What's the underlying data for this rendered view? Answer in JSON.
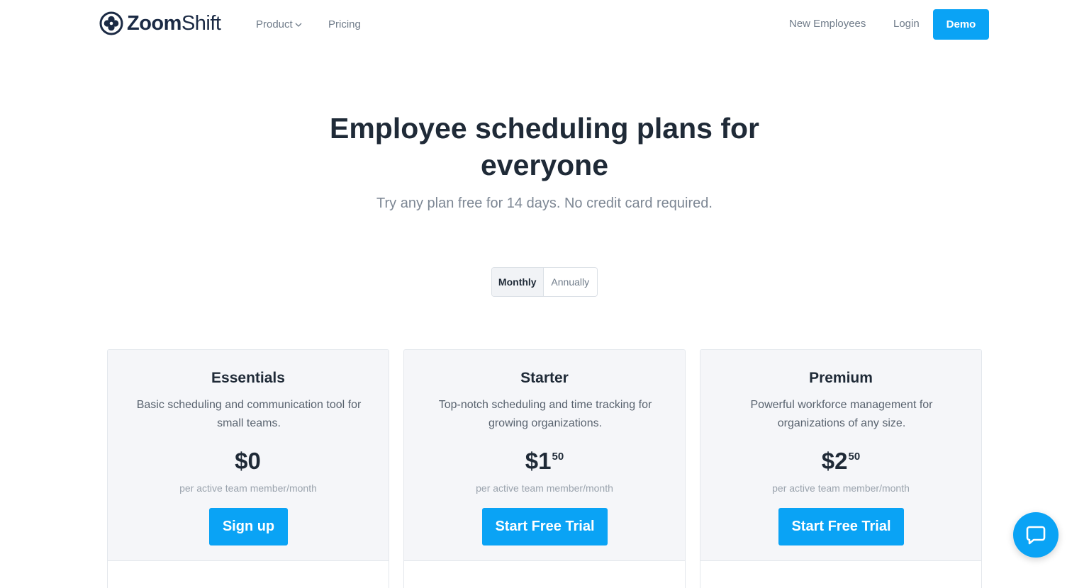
{
  "nav": {
    "logo_bold": "Zoom",
    "logo_light": "Shift",
    "product_label": "Product",
    "pricing_label": "Pricing",
    "new_employees_label": "New Employees",
    "login_label": "Login",
    "demo_label": "Demo"
  },
  "hero": {
    "title_line1": "Employee scheduling plans for",
    "title_line2": "everyone",
    "subtitle": "Try any plan free for 14 days. No credit card required."
  },
  "billing_toggle": {
    "monthly_label": "Monthly",
    "annually_label": "Annually",
    "selected": "Monthly"
  },
  "plans": [
    {
      "name": "Essentials",
      "description": "Basic scheduling and communication tool for small teams.",
      "price_main": "$0",
      "price_cents": "",
      "price_note": "per active team member/month",
      "cta_label": "Sign up"
    },
    {
      "name": "Starter",
      "description": "Top-notch scheduling and time tracking for growing organizations.",
      "price_main": "$1",
      "price_cents": "50",
      "price_note": "per active team member/month",
      "cta_label": "Start Free Trial"
    },
    {
      "name": "Premium",
      "description": "Powerful workforce management for organizations of any size.",
      "price_main": "$2",
      "price_cents": "50",
      "price_note": "per active team member/month",
      "cta_label": "Start Free Trial"
    }
  ],
  "icons": {
    "logo": "zoomshift-logo-icon",
    "product_dropdown": "chevron-down-icon",
    "chat": "chat-bubble-icon"
  },
  "colors": {
    "accent": "#0aa3f5",
    "text_dark": "#1f2a37",
    "text_muted": "#7d8794",
    "card_bg": "#f5f6f9"
  }
}
